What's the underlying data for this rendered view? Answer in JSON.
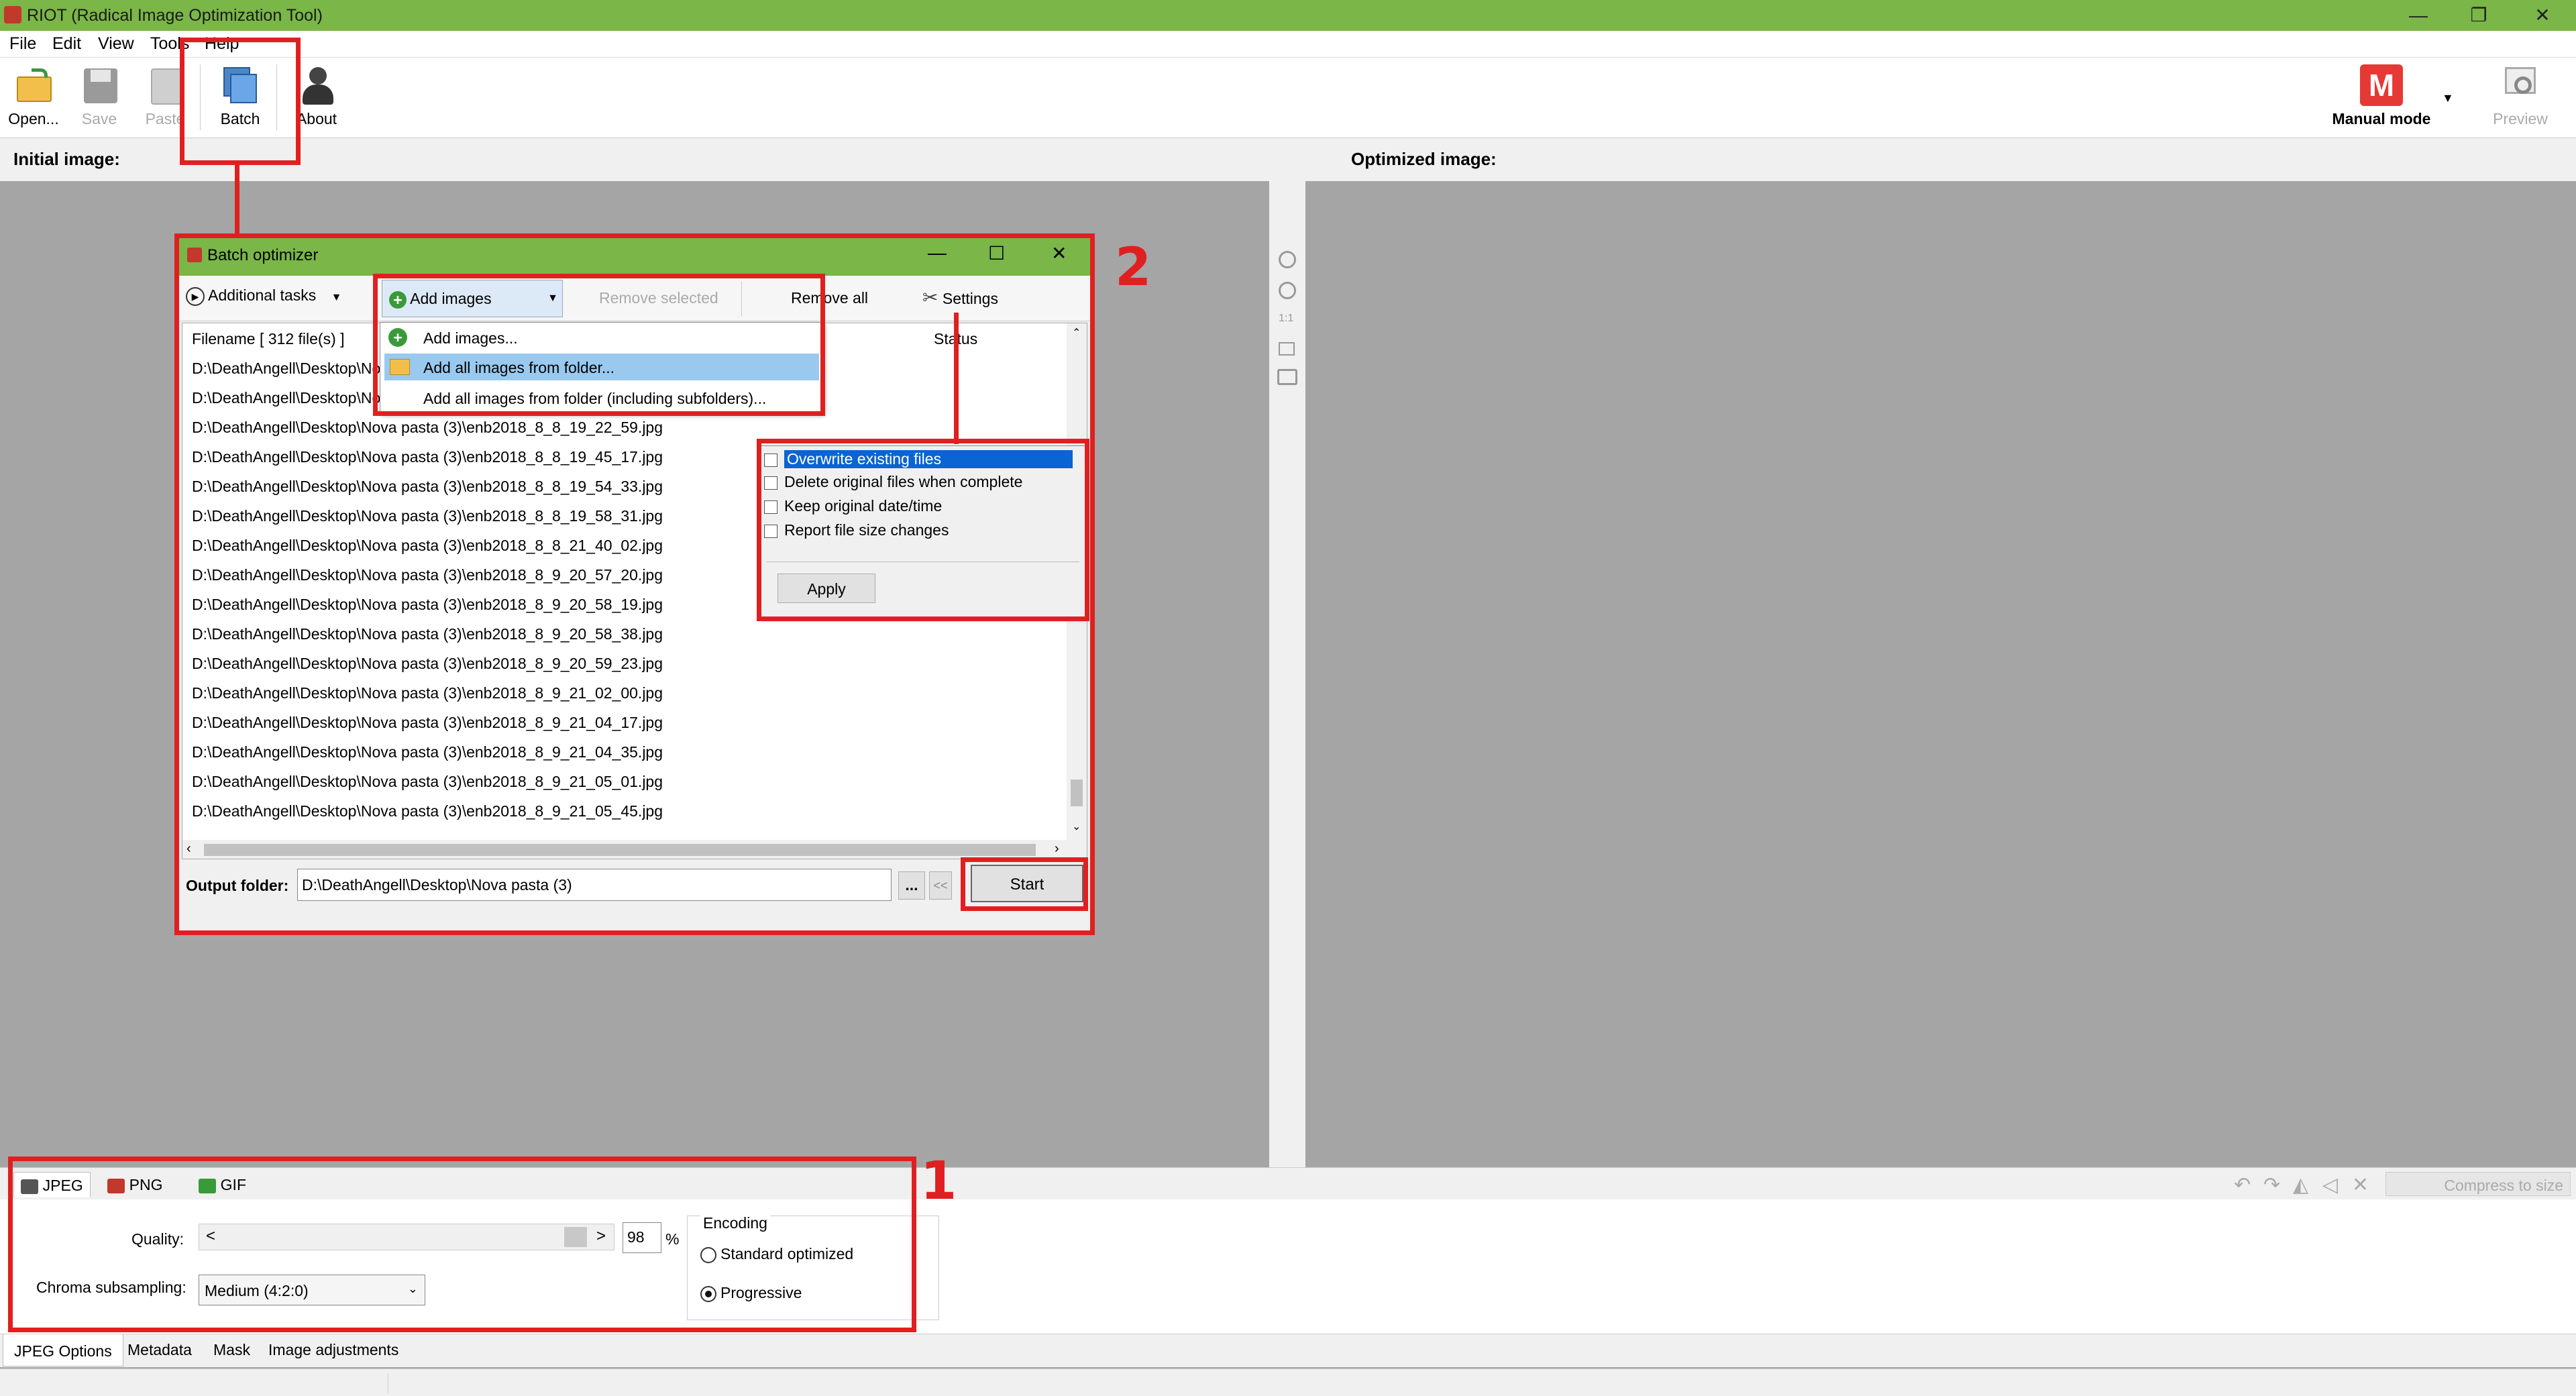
{
  "window": {
    "title": "RIOT (Radical Image Optimization Tool)"
  },
  "menu": [
    "File",
    "Edit",
    "View",
    "Tools",
    "Help"
  ],
  "toolbar": {
    "open": "Open...",
    "save": "Save",
    "paste": "Paste",
    "batch": "Batch",
    "about": "About",
    "mode": "Manual mode",
    "mode_letter": "M",
    "preview": "Preview"
  },
  "panes": {
    "initial": "Initial image:",
    "optimized": "Optimized image:"
  },
  "batch": {
    "title": "Batch optimizer",
    "additional_tasks": "Additional tasks",
    "add_images": "Add images",
    "remove_selected": "Remove selected",
    "remove_all": "Remove all",
    "settings": "Settings",
    "col_filename": "Filename [ 312 file(s) ]",
    "col_status": "Status",
    "files": [
      "D:\\DeathAngell\\Desktop\\No",
      "D:\\DeathAngell\\Desktop\\No",
      "D:\\DeathAngell\\Desktop\\Nova pasta (3)\\enb2018_8_8_19_22_59.jpg",
      "D:\\DeathAngell\\Desktop\\Nova pasta (3)\\enb2018_8_8_19_45_17.jpg",
      "D:\\DeathAngell\\Desktop\\Nova pasta (3)\\enb2018_8_8_19_54_33.jpg",
      "D:\\DeathAngell\\Desktop\\Nova pasta (3)\\enb2018_8_8_19_58_31.jpg",
      "D:\\DeathAngell\\Desktop\\Nova pasta (3)\\enb2018_8_8_21_40_02.jpg",
      "D:\\DeathAngell\\Desktop\\Nova pasta (3)\\enb2018_8_9_20_57_20.jpg",
      "D:\\DeathAngell\\Desktop\\Nova pasta (3)\\enb2018_8_9_20_58_19.jpg",
      "D:\\DeathAngell\\Desktop\\Nova pasta (3)\\enb2018_8_9_20_58_38.jpg",
      "D:\\DeathAngell\\Desktop\\Nova pasta (3)\\enb2018_8_9_20_59_23.jpg",
      "D:\\DeathAngell\\Desktop\\Nova pasta (3)\\enb2018_8_9_21_02_00.jpg",
      "D:\\DeathAngell\\Desktop\\Nova pasta (3)\\enb2018_8_9_21_04_17.jpg",
      "D:\\DeathAngell\\Desktop\\Nova pasta (3)\\enb2018_8_9_21_04_35.jpg",
      "D:\\DeathAngell\\Desktop\\Nova pasta (3)\\enb2018_8_9_21_05_01.jpg",
      "D:\\DeathAngell\\Desktop\\Nova pasta (3)\\enb2018_8_9_21_05_45.jpg"
    ],
    "add_menu": [
      "Add images...",
      "Add all images from folder...",
      "Add all images from folder (including subfolders)..."
    ],
    "settings_opts": [
      "Overwrite existing files",
      "Delete original files when complete",
      "Keep original date/time",
      "Report file size changes"
    ],
    "apply": "Apply",
    "output_label": "Output folder:",
    "output_value": "D:\\DeathAngell\\Desktop\\Nova pasta (3)",
    "browse": "...",
    "back": "<<",
    "start": "Start"
  },
  "format_tabs": [
    "JPEG",
    "PNG",
    "GIF"
  ],
  "compress": "Compress to size",
  "jpeg": {
    "quality_label": "Quality:",
    "quality": "98",
    "pct": "%",
    "left_arrow": "<",
    "right_arrow": ">",
    "chroma_label": "Chroma subsampling:",
    "chroma": "Medium (4:2:0)",
    "encoding": "Encoding",
    "standard": "Standard optimized",
    "progressive": "Progressive"
  },
  "bottom_tabs": [
    "JPEG Options",
    "Metadata",
    "Mask",
    "Image adjustments"
  ],
  "annotations": {
    "one": "1",
    "two": "2"
  }
}
